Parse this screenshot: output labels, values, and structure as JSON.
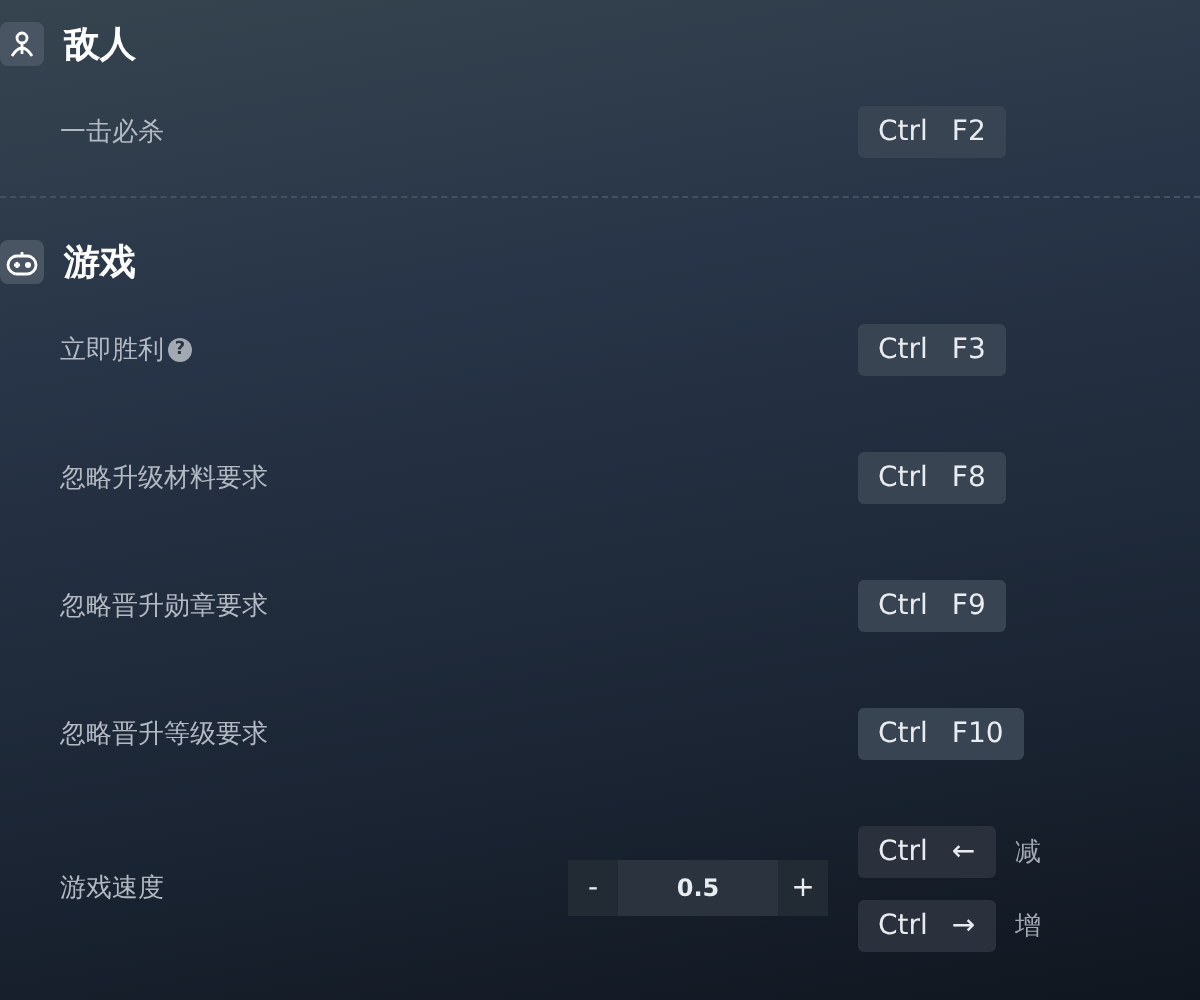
{
  "sections": [
    {
      "title": "敌人",
      "kind": "person",
      "rows": [
        {
          "kind": "hotkey",
          "label": "一击必杀",
          "keys": [
            "Ctrl",
            "F2"
          ]
        }
      ]
    },
    {
      "title": "游戏",
      "kind": "gamepad",
      "rows": [
        {
          "kind": "hotkey",
          "label": "立即胜利",
          "help": "?",
          "keys": [
            "Ctrl",
            "F3"
          ]
        },
        {
          "kind": "hotkey",
          "label": "忽略升级材料要求",
          "keys": [
            "Ctrl",
            "F8"
          ]
        },
        {
          "kind": "hotkey",
          "label": "忽略晋升勋章要求",
          "keys": [
            "Ctrl",
            "F9"
          ]
        },
        {
          "kind": "hotkey",
          "label": "忽略晋升等级要求",
          "keys": [
            "Ctrl",
            "F10"
          ]
        },
        {
          "kind": "stepper",
          "label": "游戏速度",
          "minus": "-",
          "value": "0.5",
          "plus": "+",
          "hotkeys": [
            {
              "keys": [
                "Ctrl",
                "←"
              ],
              "note": "减"
            },
            {
              "keys": [
                "Ctrl",
                "→"
              ],
              "note": "增"
            }
          ]
        }
      ]
    }
  ]
}
